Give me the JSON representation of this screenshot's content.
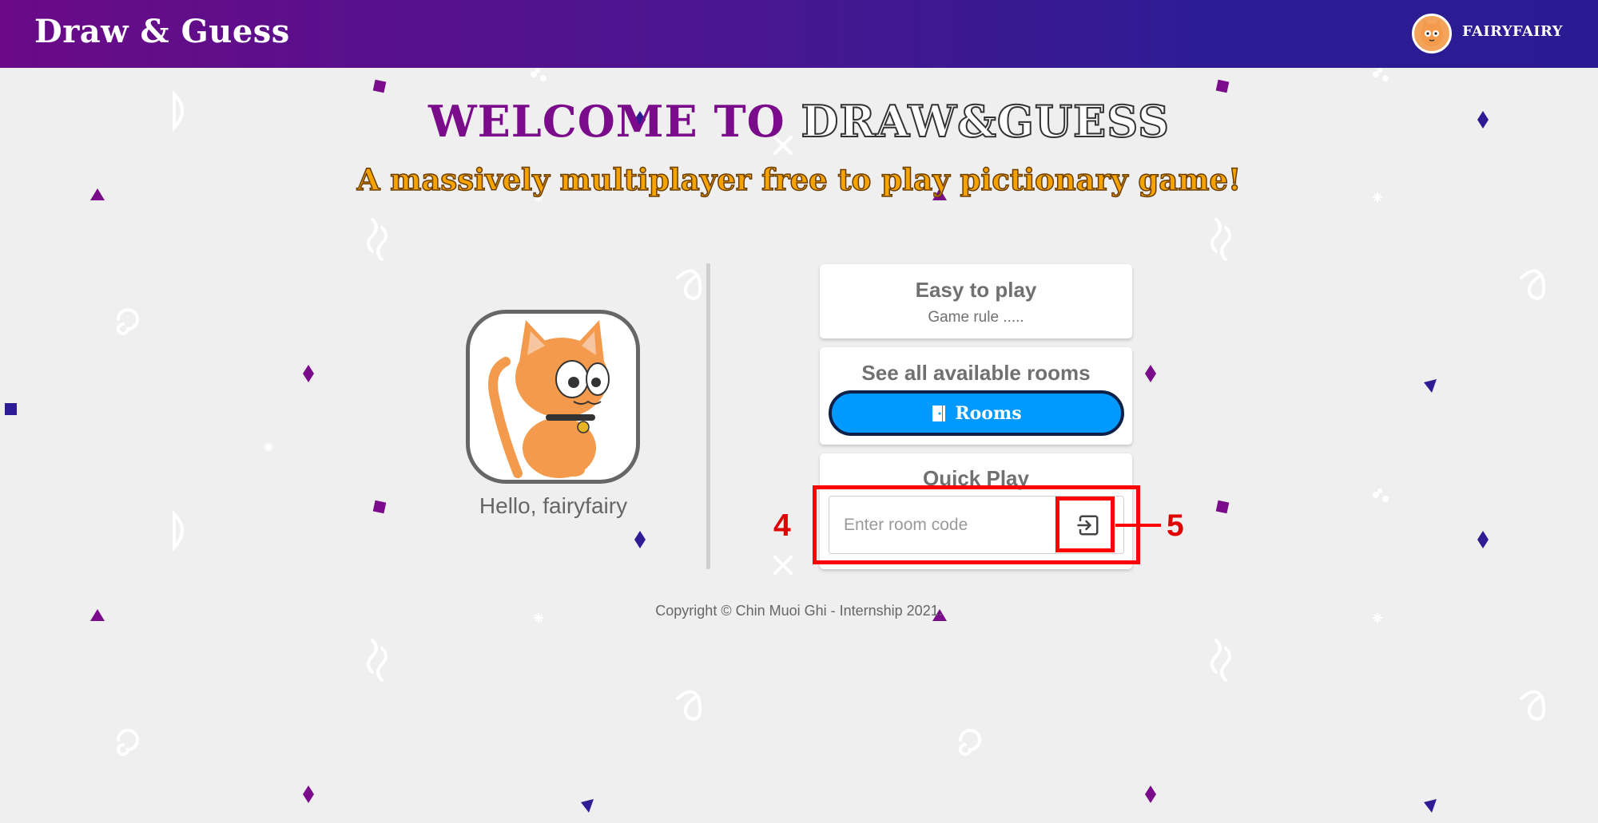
{
  "header": {
    "brand": "Draw & Guess",
    "username": "FAIRYFAIRY"
  },
  "hero": {
    "welcome_part1": "WELCOME TO",
    "welcome_part2": "DRAW&GUESS",
    "tagline": "A massively multiplayer free to play pictionary game!"
  },
  "profile": {
    "greeting": "Hello, fairyfairy"
  },
  "cards": {
    "easy_title": "Easy to play",
    "easy_sub": "Game rule .....",
    "rooms_title": "See all available rooms",
    "rooms_button": "Rooms",
    "quick_title": "Quick Play",
    "room_code_placeholder": "Enter room code",
    "room_code_value": ""
  },
  "annotations": {
    "label_4": "4",
    "label_5": "5"
  },
  "footer": {
    "copyright": "Copyright © Chin Muoi Ghi - Internship 2021."
  },
  "icons": {
    "enter": "enter-icon",
    "door": "door-icon",
    "avatar": "cat-avatar"
  },
  "colors": {
    "header_start": "#6a0a88",
    "header_end": "#2b1b92",
    "welcome_purple": "#7a0b8a",
    "tagline_orange": "#f5a300",
    "rooms_button": "#0099ff",
    "annotation_red": "#ff0000"
  }
}
